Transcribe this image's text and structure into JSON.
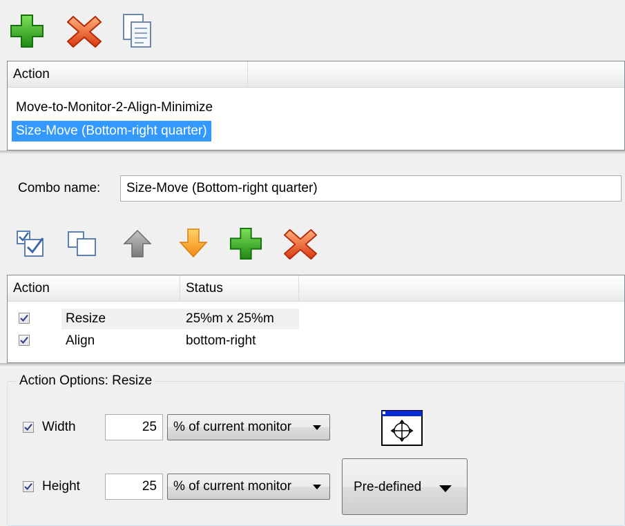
{
  "top_toolbar": {
    "icons": [
      "add-icon",
      "delete-icon",
      "copy-icon"
    ]
  },
  "combo_list": {
    "header": "Action",
    "items": [
      "Move-to-Monitor-2-Align-Minimize",
      "Size-Move (Bottom-right quarter)"
    ],
    "selected_index": 1
  },
  "combo_name": {
    "label": "Combo name:",
    "value": "Size-Move (Bottom-right quarter)"
  },
  "action_toolbar": {
    "icons": [
      "check-all-icon",
      "uncheck-all-icon",
      "move-up-icon",
      "move-down-icon",
      "add-icon",
      "delete-icon"
    ]
  },
  "action_list": {
    "headers": [
      "Action",
      "Status"
    ],
    "rows": [
      {
        "checked": true,
        "action": "Resize",
        "status": "25%m x 25%m"
      },
      {
        "checked": true,
        "action": "Align",
        "status": "bottom-right"
      }
    ]
  },
  "options": {
    "legend": "Action Options: Resize",
    "width": {
      "label": "Width",
      "checked": true,
      "value": "25",
      "unit": "% of current monitor"
    },
    "height": {
      "label": "Height",
      "checked": true,
      "value": "25",
      "unit": "% of current monitor"
    },
    "predefined_label": "Pre-defined"
  },
  "colors": {
    "selection": "#3399ff",
    "add_green": "#2f9e1a",
    "delete_orange": "#e8561b",
    "arrow_orange": "#f5a21b"
  }
}
